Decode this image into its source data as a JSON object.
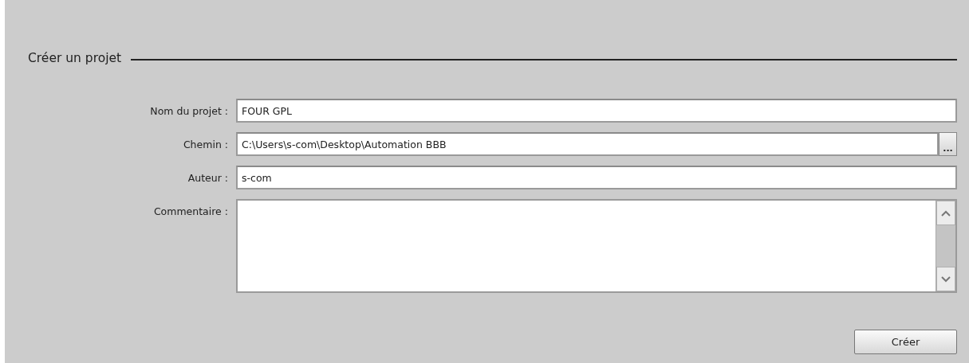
{
  "title": "Créer un projet",
  "fields": [
    {
      "kind": "text",
      "label": "Nom du projet :",
      "value": "FOUR GPL"
    },
    {
      "kind": "path",
      "label": "Chemin :",
      "value": "C:\\Users\\s-com\\Desktop\\Automation BBB",
      "browse_button": "..."
    },
    {
      "kind": "text",
      "label": "Auteur :",
      "value": "s-com"
    },
    {
      "kind": "multiline",
      "label": "Commentaire :"
    }
  ],
  "buttons": [
    "Créer"
  ]
}
